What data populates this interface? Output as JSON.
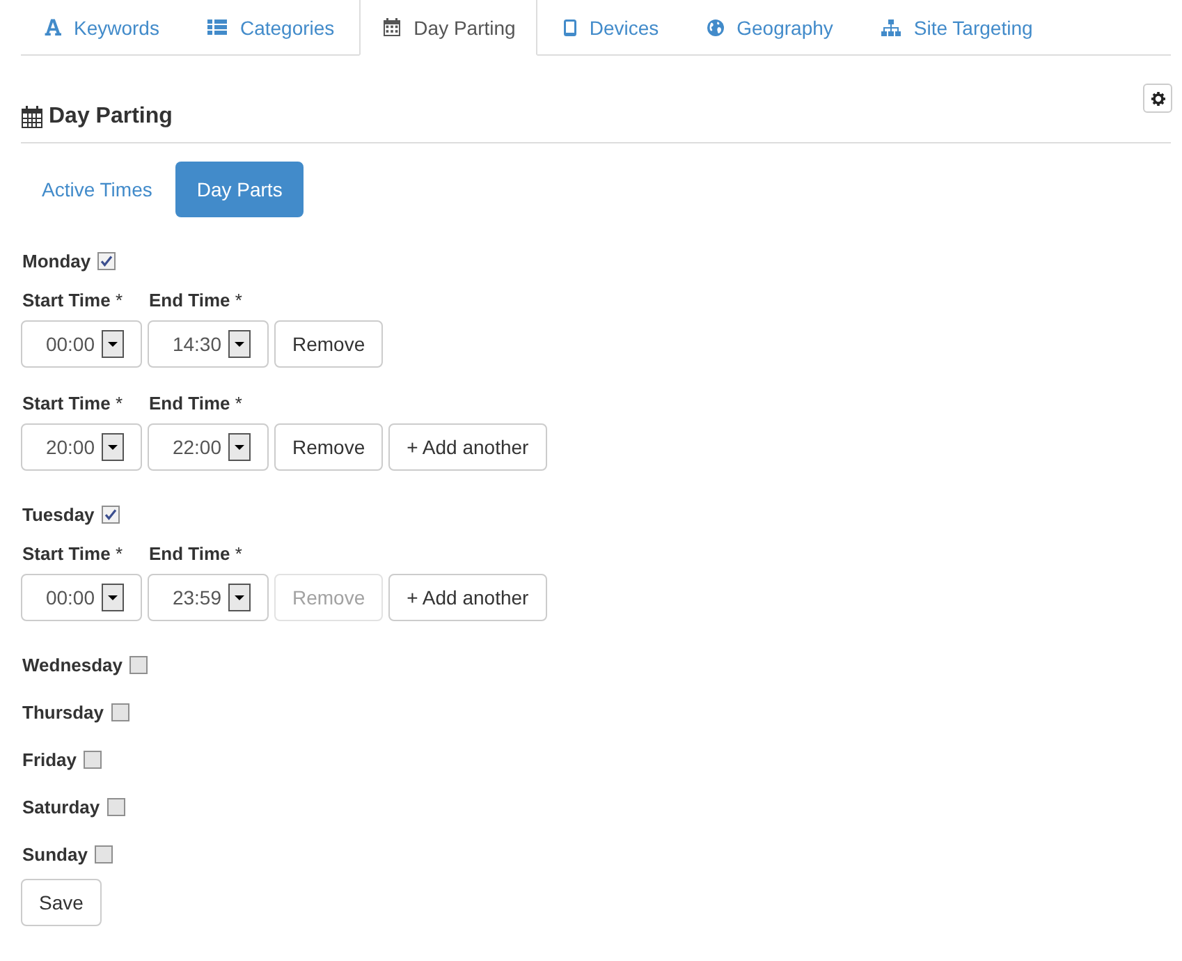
{
  "tabs": [
    {
      "label": "Keywords",
      "selected": false
    },
    {
      "label": "Categories",
      "selected": false
    },
    {
      "label": "Day Parting",
      "selected": true
    },
    {
      "label": "Devices",
      "selected": false
    },
    {
      "label": "Geography",
      "selected": false
    },
    {
      "label": "Site Targeting",
      "selected": false
    }
  ],
  "section": {
    "title": "Day Parting"
  },
  "modes": [
    {
      "label": "Active Times",
      "selected": false
    },
    {
      "label": "Day Parts",
      "selected": true
    }
  ],
  "days": [
    {
      "name": "Monday",
      "checked": true,
      "slots": [
        {
          "start_label": "**Start Time** *",
          "start": "00:00",
          "end_label": "**End Time** *",
          "end": "14:30",
          "remove": {
            "label": "Remove",
            "disabled": false
          }
        },
        {
          "start_label": "**Start Time** *",
          "start": "20:00",
          "end_label": "**End Time** *",
          "end": "22:00",
          "remove": {
            "label": "Remove",
            "disabled": false
          },
          "add": "+ Add another"
        }
      ]
    },
    {
      "name": "Tuesday",
      "checked": true,
      "slots": [
        {
          "start_label": "**Start Time** *",
          "start": "00:00",
          "end_label": "**End Time** *",
          "end": "23:59",
          "remove": {
            "label": "Remove",
            "disabled": true
          },
          "add": "+ Add another"
        }
      ]
    },
    {
      "name": "Wednesday",
      "checked": false
    },
    {
      "name": "Thursday",
      "checked": false
    },
    {
      "name": "Friday",
      "checked": false
    },
    {
      "name": "Saturday",
      "checked": false
    },
    {
      "name": "Sunday",
      "checked": false
    }
  ],
  "save_button": "Save"
}
